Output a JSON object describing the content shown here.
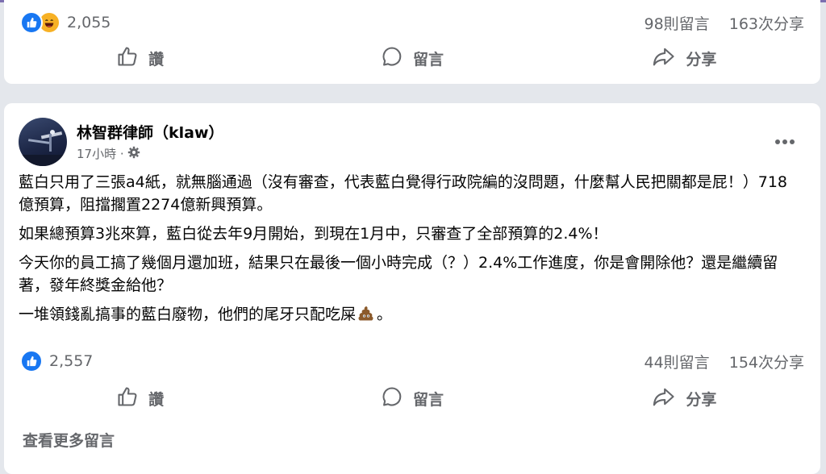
{
  "post1": {
    "reactions": "2,055",
    "comments": "98則留言",
    "shares": "163次分享",
    "actions": {
      "like": "讚",
      "comment": "留言",
      "share": "分享"
    }
  },
  "post2": {
    "author": "林智群律師（klaw）",
    "time": "17小時 ·",
    "paragraphs": [
      "藍白只用了三張a4紙，就無腦通過（沒有審查，代表藍白覺得行政院編的沒問題，什麼幫人民把關都是屁！）718億預算，阻擋擱置2274億新興預算。",
      "如果總預算3兆來算，藍白從去年9月開始，到現在1月中，只審查了全部預算的2.4%！",
      "今天你的員工搞了幾個月還加班，結果只在最後一個小時完成（？）2.4%工作進度，你是會開除他？還是繼續留著，發年終獎金給他？"
    ],
    "last_paragraph_text": "一堆領錢亂搞事的藍白廢物，他們的尾牙只配吃屎",
    "last_paragraph_end": "。",
    "reactions": "2,557",
    "comments": "44則留言",
    "shares": "154次分享",
    "actions": {
      "like": "讚",
      "comment": "留言",
      "share": "分享"
    },
    "view_more": "查看更多留言"
  },
  "colors": {
    "like_blue": "#1877f2",
    "secondary_text": "#65676b",
    "card_bg": "#ffffff",
    "page_bg": "#e4e7ec"
  },
  "icons": [
    "like-reaction-icon",
    "haha-reaction-icon",
    "thumbs-up-icon",
    "comment-bubble-icon",
    "share-arrow-icon",
    "gear-icon",
    "more-options-icon",
    "poop-emoji-icon"
  ]
}
